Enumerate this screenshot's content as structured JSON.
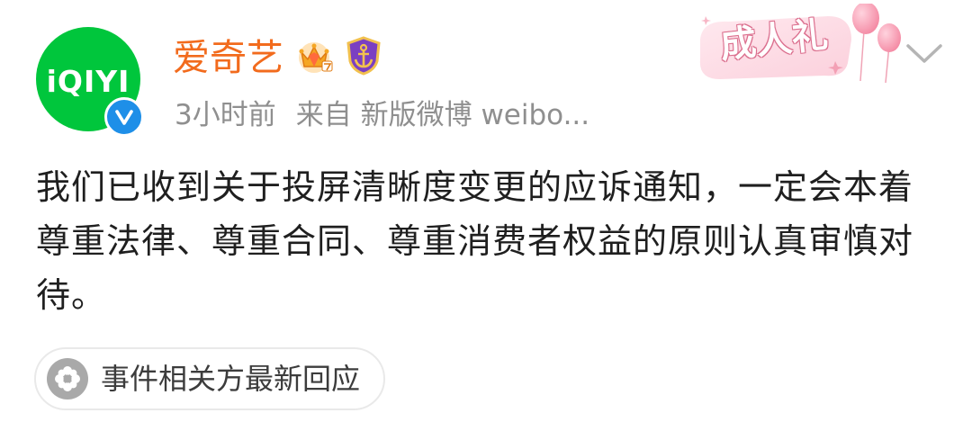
{
  "post": {
    "author": {
      "avatar_text": "iQIYI",
      "name": "爱奇艺",
      "verified": true
    },
    "meta": {
      "time": "3小时前",
      "source": "来自 新版微博 weibo..."
    },
    "banner": {
      "label": "成人礼"
    },
    "content": "我们已收到关于投屏清晰度变更的应诉通知，一定会本着尊重法律、尊重合同、尊重消费者权益的原则认真审慎对待。",
    "topic": {
      "label": "事件相关方最新回应",
      "icon": "flower-icon"
    }
  },
  "colors": {
    "avatar_bg": "#00c63c",
    "username": "#f26b1d",
    "meta": "#8f8f8f",
    "verified": "#1e8fe8",
    "text": "#1f1f1f"
  }
}
